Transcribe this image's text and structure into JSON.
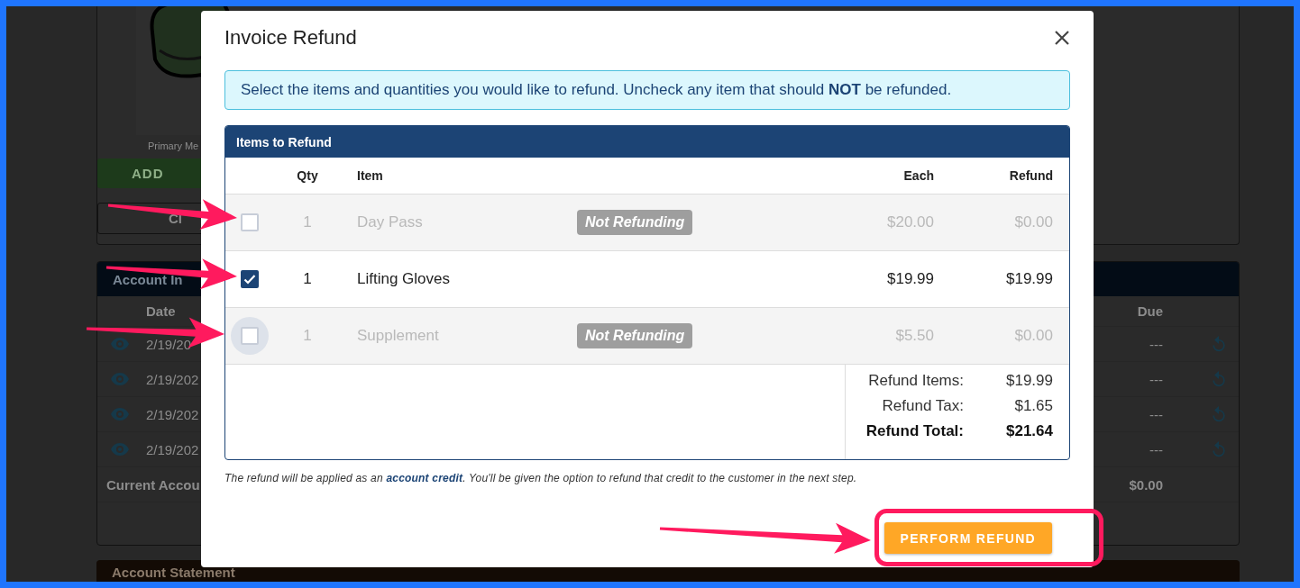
{
  "background": {
    "caption": "Primary Me",
    "add_button": "ADD",
    "outline_button": "Cl",
    "account_panel": {
      "title": "Account In",
      "columns": [
        "Date",
        "Due"
      ],
      "rows": [
        {
          "date": "2/19/20",
          "due": "---"
        },
        {
          "date": "2/19/202",
          "due": "---"
        },
        {
          "date": "2/19/202",
          "due": "---"
        },
        {
          "date": "2/19/202",
          "due": "---"
        }
      ],
      "total_label": "Current Accou",
      "total_due": "$0.00"
    },
    "statement_title": "Account Statement"
  },
  "dialog": {
    "title": "Invoice Refund",
    "notice": "Select the items and quantities you would like to refund. Uncheck any item that should **NOT** be refunded.",
    "table": {
      "title": "Items to Refund",
      "columns": [
        "Qty",
        "Item",
        "Each",
        "Refund"
      ],
      "rows": [
        {
          "checked": false,
          "focused": false,
          "qty": "1",
          "item": "Day Pass",
          "badge": "Not Refunding",
          "each": "$20.00",
          "refund": "$0.00"
        },
        {
          "checked": true,
          "focused": false,
          "qty": "1",
          "item": "Lifting Gloves",
          "each": "$19.99",
          "refund": "$19.99"
        },
        {
          "checked": false,
          "focused": true,
          "qty": "1",
          "item": "Supplement",
          "badge": "Not Refunding",
          "each": "$5.50",
          "refund": "$0.00"
        }
      ],
      "summary": [
        {
          "kind": "line",
          "label": "Refund Items:",
          "value": "$19.99"
        },
        {
          "kind": "line",
          "label": "Refund Tax:",
          "value": "$1.65"
        },
        {
          "kind": "total",
          "label": "Refund Total:",
          "value": "$21.64"
        }
      ]
    },
    "footnote_before": "The refund will be applied as an ",
    "footnote_link": "account credit",
    "footnote_after": ". You'll be given the option to refund that credit to the customer in the next step.",
    "button": "PERFORM REFUND"
  }
}
